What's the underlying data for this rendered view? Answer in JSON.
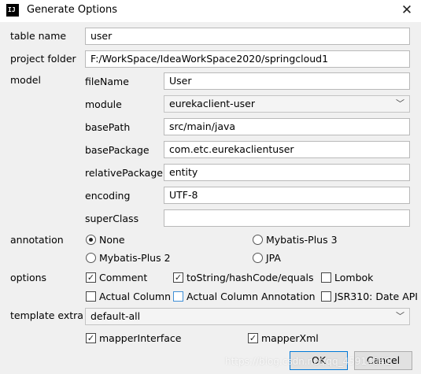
{
  "window": {
    "title": "Generate Options",
    "close_icon": "close-icon",
    "app_icon": "IJ"
  },
  "table_name": {
    "label": "table name",
    "value": "user"
  },
  "project_folder": {
    "label": "project folder",
    "value": "F:/WorkSpace/IdeaWorkSpace2020/springcloud1"
  },
  "model": {
    "label": "model",
    "fileName": {
      "label": "fileName",
      "value": "User"
    },
    "module": {
      "label": "module",
      "value": "eurekaclient-user"
    },
    "basePath": {
      "label": "basePath",
      "value": "src/main/java"
    },
    "basePackage": {
      "label": "basePackage",
      "value": "com.etc.eurekaclientuser"
    },
    "relativePackage": {
      "label": "relativePackage",
      "value": "entity"
    },
    "encoding": {
      "label": "encoding",
      "value": "UTF-8"
    },
    "superClass": {
      "label": "superClass",
      "value": ""
    }
  },
  "annotation": {
    "label": "annotation",
    "options": [
      {
        "label": "None",
        "selected": true
      },
      {
        "label": "Mybatis-Plus 3",
        "selected": false
      },
      {
        "label": "Mybatis-Plus 2",
        "selected": false
      },
      {
        "label": "JPA",
        "selected": false
      }
    ]
  },
  "options": {
    "label": "options",
    "items": [
      {
        "label": "Comment",
        "checked": true
      },
      {
        "label": "toString/hashCode/equals",
        "checked": true
      },
      {
        "label": "Lombok",
        "checked": false
      },
      {
        "label": "Actual Column",
        "checked": false
      },
      {
        "label": "Actual Column Annotation",
        "checked": false
      },
      {
        "label": "JSR310: Date API",
        "checked": false
      }
    ]
  },
  "template_extra": {
    "label": "template extra",
    "value": "default-all",
    "items": [
      {
        "label": "mapperInterface",
        "checked": true
      },
      {
        "label": "mapperXml",
        "checked": true
      }
    ]
  },
  "buttons": {
    "ok": "OK",
    "cancel": "Cancel"
  },
  "watermark": "https://blog.csdn.net/qq_45914041"
}
